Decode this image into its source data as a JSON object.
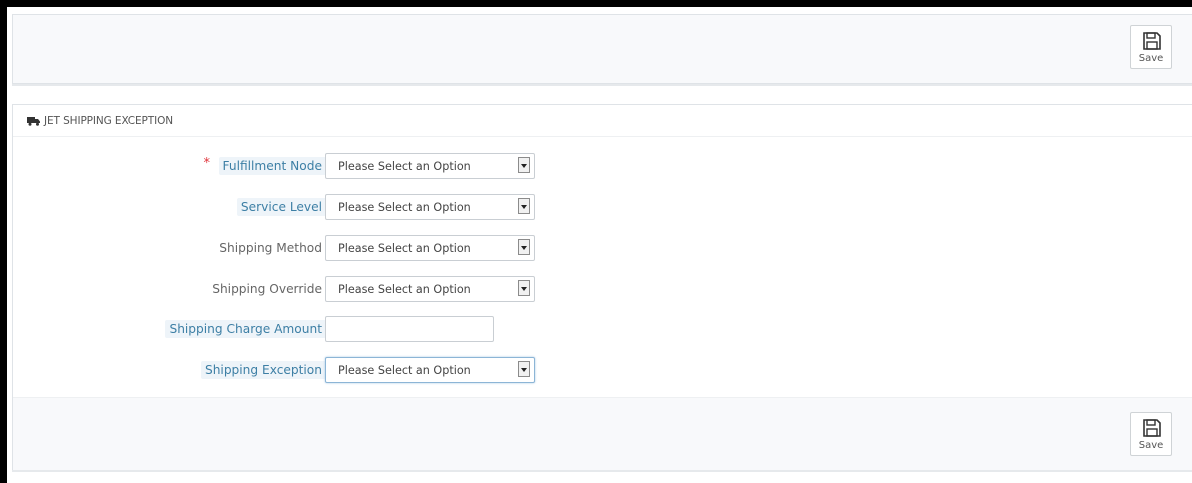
{
  "toolbar": {
    "save_label": "Save",
    "save_icon": "floppy-disk-icon"
  },
  "panel": {
    "heading_icon": "truck-icon",
    "title": "JET SHIPPING EXCEPTION"
  },
  "form": {
    "required_marker": "*",
    "fields": [
      {
        "label": "Fulfillment Node",
        "type": "select",
        "value": "Please Select an Option",
        "required": true,
        "hint": true
      },
      {
        "label": "Service Level",
        "type": "select",
        "value": "Please Select an Option",
        "required": false,
        "hint": true
      },
      {
        "label": "Shipping Method",
        "type": "select",
        "value": "Please Select an Option",
        "required": false,
        "hint": false
      },
      {
        "label": "Shipping Override",
        "type": "select",
        "value": "Please Select an Option",
        "required": false,
        "hint": false
      },
      {
        "label": "Shipping Charge Amount",
        "type": "text",
        "value": "",
        "required": false,
        "hint": true
      },
      {
        "label": "Shipping Exception",
        "type": "select",
        "value": "Please Select an Option",
        "required": false,
        "hint": true
      }
    ]
  },
  "footer": {
    "save_label": "Save",
    "save_icon": "floppy-disk-icon"
  }
}
